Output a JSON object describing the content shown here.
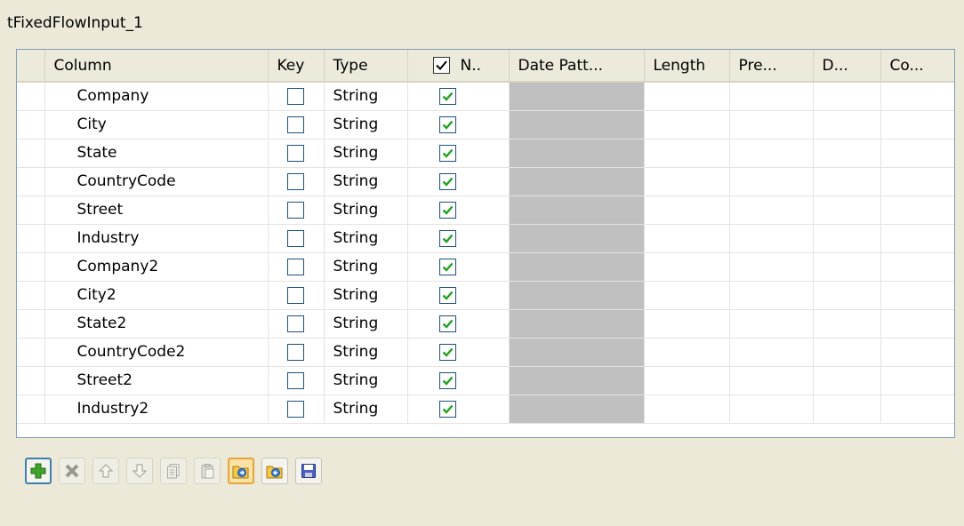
{
  "panel": {
    "title": "tFixedFlowInput_1"
  },
  "columns": {
    "column": "Column",
    "key": "Key",
    "type": "Type",
    "nullable": "N..",
    "date_pattern": "Date Patt...",
    "length": "Length",
    "precision": "Pre...",
    "default": "D...",
    "comment": "Co..."
  },
  "rows": [
    {
      "name": "Company",
      "type": "String",
      "key": false,
      "nullable": true
    },
    {
      "name": "City",
      "type": "String",
      "key": false,
      "nullable": true
    },
    {
      "name": "State",
      "type": "String",
      "key": false,
      "nullable": true
    },
    {
      "name": "CountryCode",
      "type": "String",
      "key": false,
      "nullable": true
    },
    {
      "name": "Street",
      "type": "String",
      "key": false,
      "nullable": true
    },
    {
      "name": "Industry",
      "type": "String",
      "key": false,
      "nullable": true
    },
    {
      "name": "Company2",
      "type": "String",
      "key": false,
      "nullable": true
    },
    {
      "name": "City2",
      "type": "String",
      "key": false,
      "nullable": true
    },
    {
      "name": "State2",
      "type": "String",
      "key": false,
      "nullable": true
    },
    {
      "name": "CountryCode2",
      "type": "String",
      "key": false,
      "nullable": true
    },
    {
      "name": "Street2",
      "type": "String",
      "key": false,
      "nullable": true
    },
    {
      "name": "Industry2",
      "type": "String",
      "key": false,
      "nullable": true
    }
  ],
  "toolbar": [
    {
      "icon": "add-icon",
      "state": "active"
    },
    {
      "icon": "delete-icon",
      "state": "disabled"
    },
    {
      "icon": "move-up-icon",
      "state": "disabled"
    },
    {
      "icon": "move-down-icon",
      "state": "disabled"
    },
    {
      "icon": "copy-icon",
      "state": "disabled"
    },
    {
      "icon": "paste-icon",
      "state": "disabled"
    },
    {
      "icon": "import-icon",
      "state": "hover"
    },
    {
      "icon": "export-icon",
      "state": "normal"
    },
    {
      "icon": "save-icon",
      "state": "normal"
    }
  ],
  "colors": {
    "check_green": "#21a121",
    "date_pattern_fill": "#c0c0c0",
    "accent_border": "#3c7fb1"
  }
}
